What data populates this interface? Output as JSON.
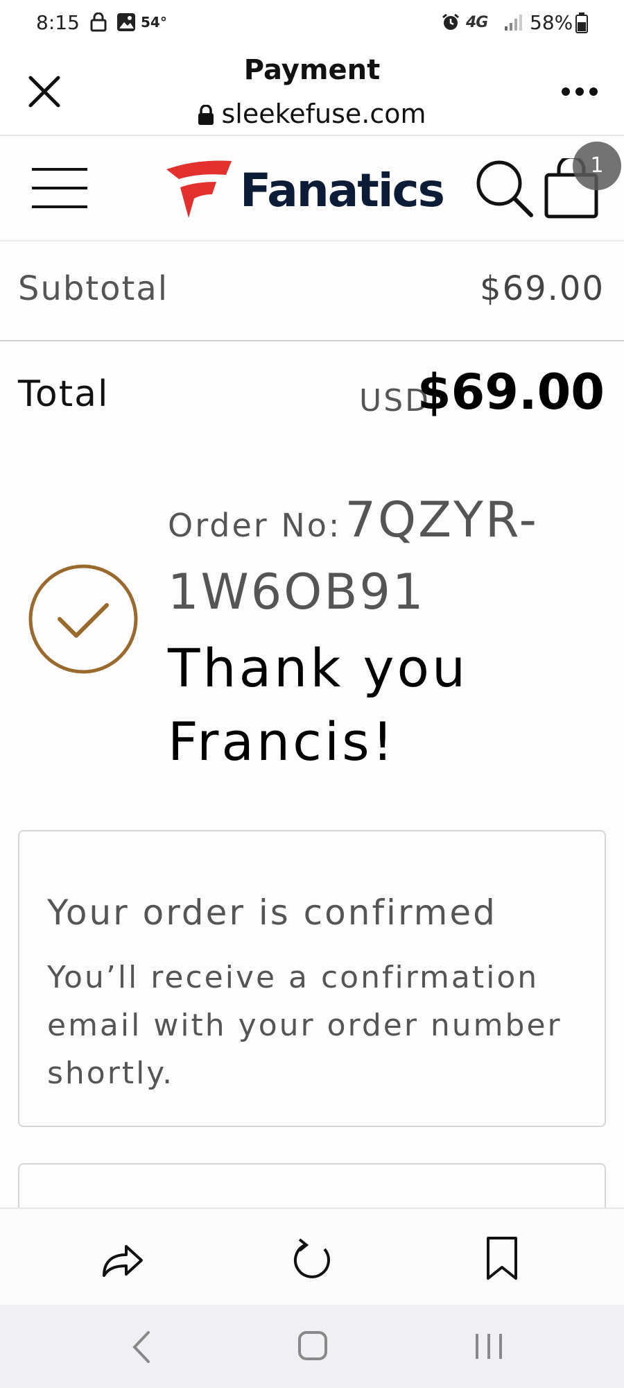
{
  "status_bar": {
    "time": "8:15",
    "temperature": "54°",
    "network": "4G",
    "battery": "58%"
  },
  "browser": {
    "title": "Payment",
    "url": "sleekefuse.com",
    "icons": [
      "close-icon",
      "lock-icon",
      "more-icon"
    ]
  },
  "site": {
    "brand": "Fanatics",
    "cart_count": "1",
    "brand_color": "#e2302f",
    "navy_color": "#0d1c36",
    "icons": [
      "menu-icon",
      "search-icon",
      "cart-icon"
    ]
  },
  "summary": {
    "subtotal_label": "Subtotal",
    "subtotal_value": "$69.00",
    "total_label": "Total",
    "currency": "USD",
    "total_value": "$69.00"
  },
  "confirmation": {
    "order_label": "Order No:",
    "order_number_part1": "7QZYR-",
    "order_number_part2": "1W6OB91",
    "thank_line1": "Thank you",
    "thank_line2": "Francis!",
    "check_color": "#9a6a2c",
    "card_title": "Your order is confirmed",
    "card_body": "You’ll receive a confirmation email with your order number shortly."
  },
  "toolbar": {
    "icons": [
      "share-icon",
      "reload-icon",
      "bookmark-icon"
    ]
  },
  "nav": {
    "icons": [
      "back-icon",
      "home-icon",
      "recent-apps-icon"
    ]
  }
}
